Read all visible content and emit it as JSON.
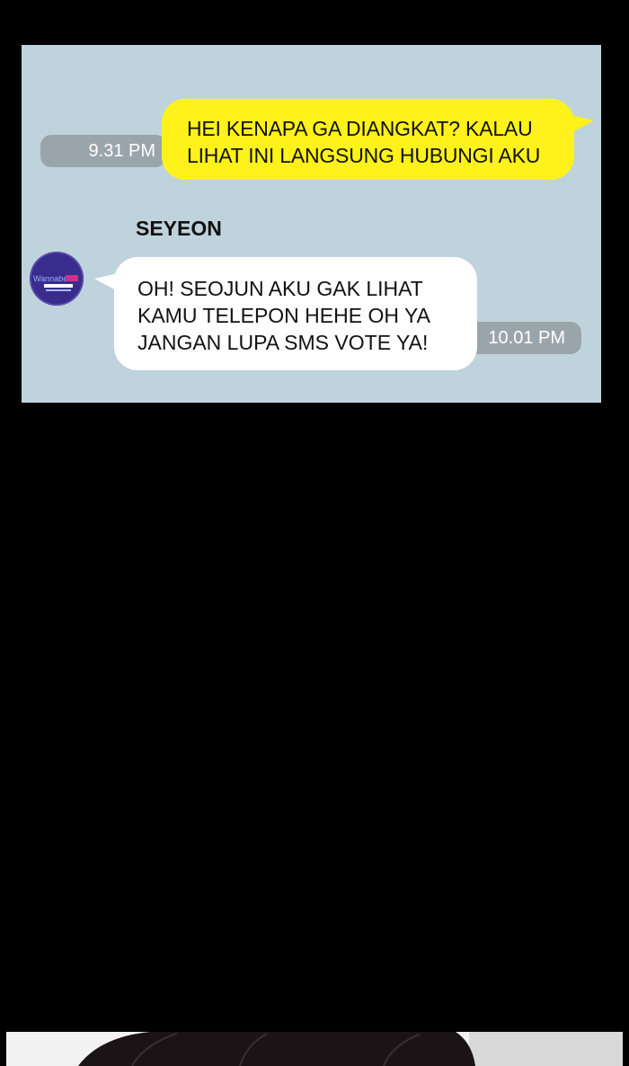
{
  "chat": {
    "outgoing": {
      "lines": [
        "HEI KENAPA GA DIANGKAT? KALAU",
        "LIHAT INI LANGSUNG HUBUNGI AKU"
      ],
      "time": "9.31 PM",
      "bubble_color": "#fff21a"
    },
    "incoming": {
      "sender": "SEYEON",
      "lines": [
        "OH! SEOJUN AKU GAK LIHAT",
        "KAMU TELEPON HEHE OH YA",
        "JANGAN LUPA SMS VOTE YA!"
      ],
      "time": "10.01 PM",
      "avatar_logo_text": "Wannabe"
    },
    "background_color": "#bfd3dd"
  }
}
